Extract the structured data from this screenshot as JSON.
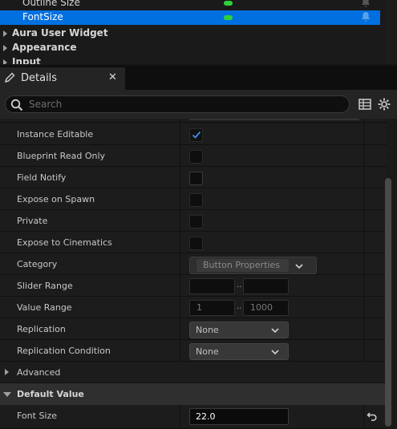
{
  "variables": {
    "rows": [
      {
        "name": "Outline Size",
        "selected": false
      },
      {
        "name": "FontSize",
        "selected": true
      }
    ],
    "categories": [
      "Aura User Widget",
      "Appearance",
      "Input"
    ]
  },
  "details_tab": {
    "title": "Details",
    "close": "✕"
  },
  "search": {
    "placeholder": "Search"
  },
  "properties": {
    "instance_editable": {
      "label": "Instance Editable",
      "checked": true
    },
    "blueprint_read_only": {
      "label": "Blueprint Read Only",
      "checked": false
    },
    "field_notify": {
      "label": "Field Notify",
      "checked": false
    },
    "expose_on_spawn": {
      "label": "Expose on Spawn",
      "checked": false
    },
    "private": {
      "label": "Private",
      "checked": false
    },
    "expose_to_cinematics": {
      "label": "Expose to Cinematics",
      "checked": false
    },
    "category": {
      "label": "Category",
      "value": "Button Properties"
    },
    "slider_range": {
      "label": "Slider Range",
      "sep": "..",
      "min": "",
      "max": ""
    },
    "value_range": {
      "label": "Value Range",
      "sep": "..",
      "min": "1",
      "max": "1000"
    },
    "replication": {
      "label": "Replication",
      "value": "None"
    },
    "replication_condition": {
      "label": "Replication Condition",
      "value": "None"
    }
  },
  "sections": {
    "advanced": "Advanced",
    "default_value": "Default Value"
  },
  "default_value": {
    "font_size": {
      "label": "Font Size",
      "value": "22.0"
    }
  },
  "colors": {
    "selection": "#0070e0",
    "flag_green": "#2fd13a",
    "check_blue": "#3d8fe6"
  }
}
